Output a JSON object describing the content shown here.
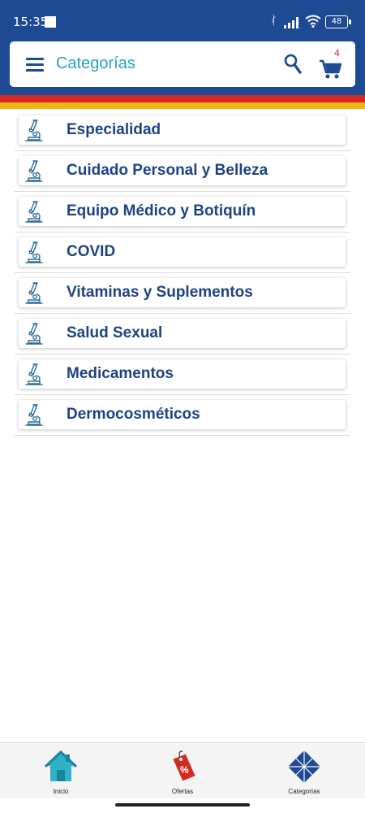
{
  "status_bar": {
    "time": "15:35",
    "battery": "48"
  },
  "app_bar": {
    "title": "Categorías",
    "cart_count": "4",
    "menu_icon": "hamburger-menu-icon",
    "search_icon": "search-icon",
    "cart_icon": "shopping-cart-icon"
  },
  "categories": [
    {
      "label": "Especialidad",
      "icon": "microscope-icon"
    },
    {
      "label": "Cuidado Personal y Belleza",
      "icon": "microscope-icon"
    },
    {
      "label": "Equipo Médico y Botiquín",
      "icon": "microscope-icon"
    },
    {
      "label": "COVID",
      "icon": "microscope-icon"
    },
    {
      "label": "Vitaminas y Suplementos",
      "icon": "microscope-icon"
    },
    {
      "label": "Salud Sexual",
      "icon": "microscope-icon"
    },
    {
      "label": "Medicamentos",
      "icon": "microscope-icon"
    },
    {
      "label": "Dermocosméticos",
      "icon": "microscope-icon"
    }
  ],
  "bottom_nav": {
    "items": [
      {
        "label": "Inicio",
        "icon": "home-icon"
      },
      {
        "label": "Ofertas",
        "icon": "discount-tag-icon"
      },
      {
        "label": "Categorías",
        "icon": "categories-diamond-icon"
      }
    ]
  },
  "colors": {
    "brand_blue": "#1d4a93",
    "accent_teal": "#2a9fbc",
    "stripe_red": "#d42a22",
    "stripe_yellow": "#f2b416",
    "category_text": "#1e4385"
  }
}
